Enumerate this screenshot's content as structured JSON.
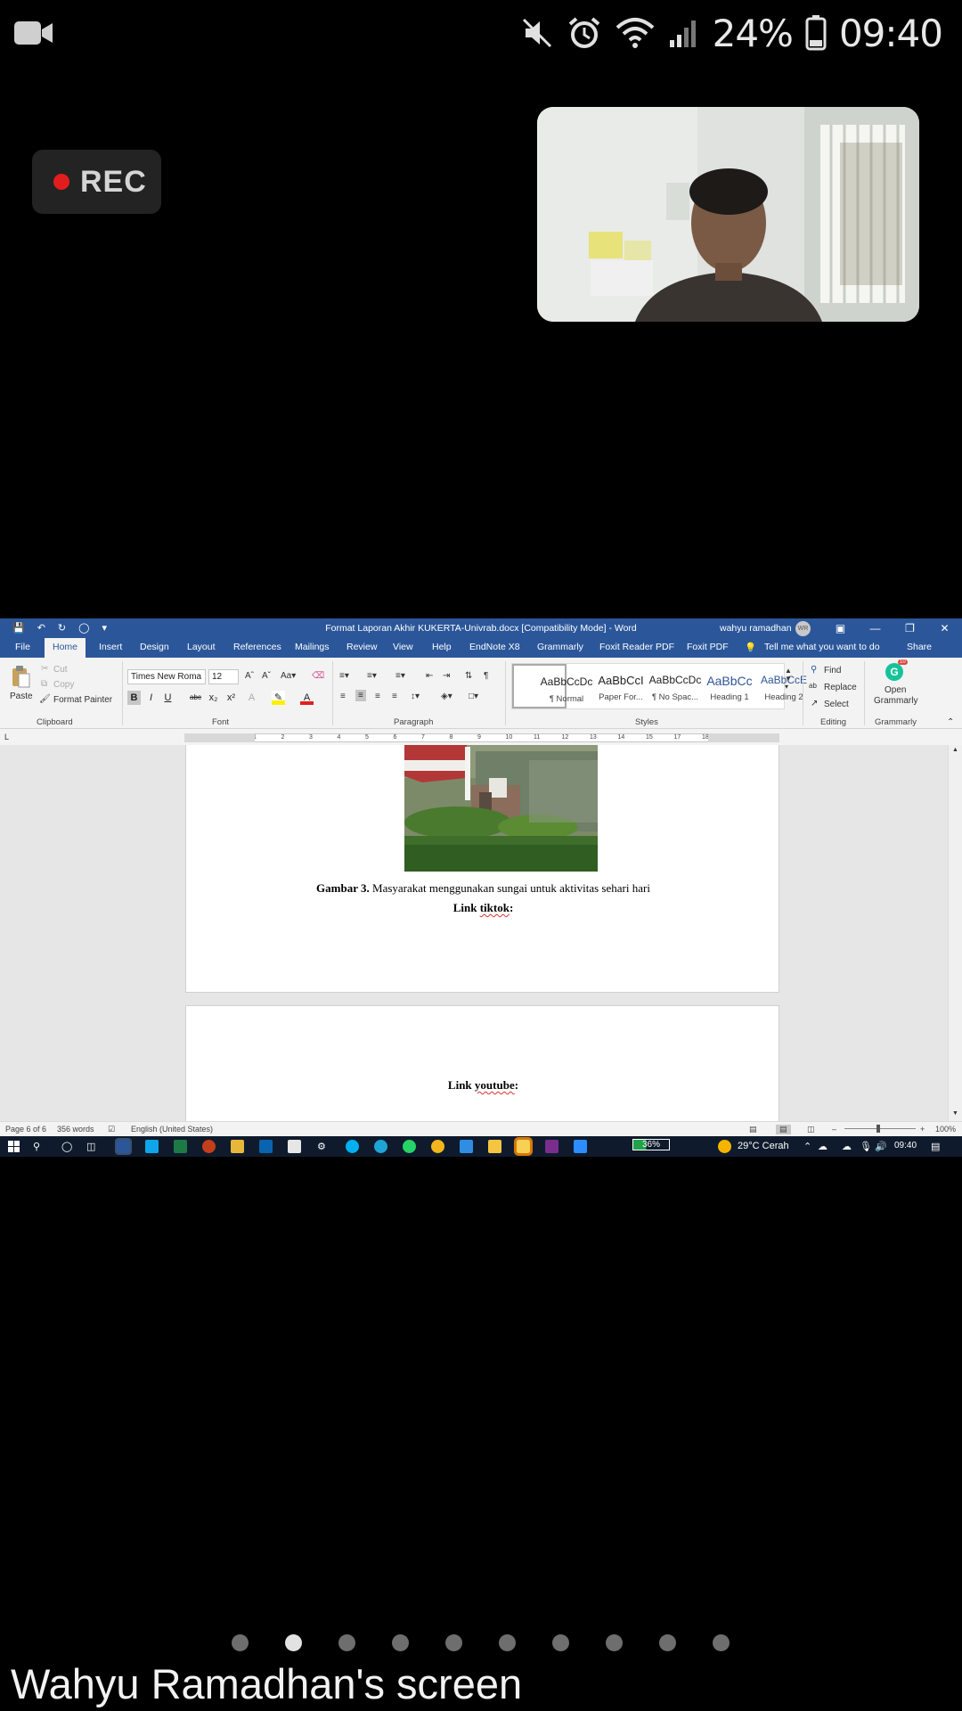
{
  "status_bar": {
    "battery_percent": "24%",
    "time": "09:40",
    "icons": [
      "video-camera-icon",
      "mute-icon",
      "alarm-icon",
      "wifi-icon",
      "signal-icon",
      "battery-icon"
    ]
  },
  "recording": {
    "label": "REC",
    "dot_color": "#e11d1d"
  },
  "shared_screen": {
    "window_title": "Format Laporan Akhir KUKERTA-Univrab.docx [Compatibility Mode]  -  Word",
    "user_name": "wahyu ramadhan",
    "user_initials": "WR",
    "brand_color": "#2b579a",
    "tabs": [
      "File",
      "Home",
      "Insert",
      "Design",
      "Layout",
      "References",
      "Mailings",
      "Review",
      "View",
      "Help",
      "EndNote X8",
      "Grammarly",
      "Foxit Reader PDF",
      "Foxit PDF"
    ],
    "active_tab": "Home",
    "tell_me": "Tell me what you want to do",
    "share_label": "Share",
    "ribbon": {
      "clipboard": {
        "paste": "Paste",
        "cut": "Cut",
        "copy": "Copy",
        "format_painter": "Format Painter",
        "label": "Clipboard"
      },
      "font": {
        "font_name": "Times New Roma",
        "font_size": "12",
        "label": "Font"
      },
      "paragraph": {
        "label": "Paragraph"
      },
      "styles": {
        "label": "Styles",
        "items": [
          {
            "sample": "AaBbCcDc",
            "name": "¶ Normal"
          },
          {
            "sample": "AaBbCcI",
            "name": "Paper For..."
          },
          {
            "sample": "AaBbCcDc",
            "name": "¶ No Spac..."
          },
          {
            "sample": "AaBbCc",
            "name": "Heading 1"
          },
          {
            "sample": "AaBbCcE",
            "name": "Heading 2"
          }
        ]
      },
      "editing": {
        "find": "Find",
        "replace": "Replace",
        "select": "Select",
        "label": "Editing"
      },
      "grammarly": {
        "open": "Open",
        "name": "Grammarly",
        "label": "Grammarly",
        "badge": "10"
      }
    },
    "ruler_numbers": [
      "2",
      "1",
      "1",
      "2",
      "3",
      "4",
      "5",
      "6",
      "7",
      "8",
      "9",
      "10",
      "11",
      "12",
      "13",
      "14",
      "15",
      "17",
      "18"
    ],
    "document": {
      "caption_bold": "Gambar 3.",
      "caption_text": "Masyarakat menggunakan sungai untuk aktivitas sehari hari",
      "link_tiktok_prefix": "Link ",
      "link_tiktok_word": "tiktok",
      "link_youtube_prefix": "Link ",
      "link_youtube_word": "youtube",
      "colon": ":"
    },
    "statusline": {
      "page": "Page 6 of 6",
      "words": "356 words",
      "language": "English (United States)",
      "zoom": "100%"
    },
    "taskbar": {
      "battery": "36%",
      "weather": "29°C  Cerah",
      "time": "09:40"
    }
  },
  "pager": {
    "count": 10,
    "active_index": 1
  },
  "caption": "Wahyu Ramadhan's screen"
}
